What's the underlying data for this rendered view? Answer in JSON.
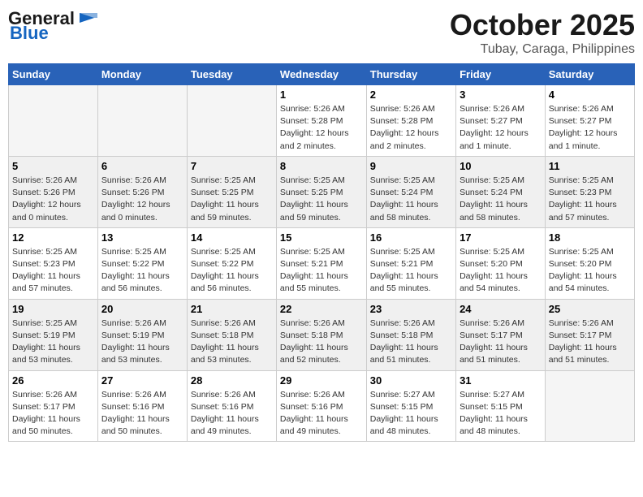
{
  "header": {
    "logo_line1": "General",
    "logo_line2": "Blue",
    "month": "October 2025",
    "location": "Tubay, Caraga, Philippines"
  },
  "weekdays": [
    "Sunday",
    "Monday",
    "Tuesday",
    "Wednesday",
    "Thursday",
    "Friday",
    "Saturday"
  ],
  "weeks": [
    [
      {
        "day": "",
        "info": ""
      },
      {
        "day": "",
        "info": ""
      },
      {
        "day": "",
        "info": ""
      },
      {
        "day": "1",
        "info": "Sunrise: 5:26 AM\nSunset: 5:28 PM\nDaylight: 12 hours\nand 2 minutes."
      },
      {
        "day": "2",
        "info": "Sunrise: 5:26 AM\nSunset: 5:28 PM\nDaylight: 12 hours\nand 2 minutes."
      },
      {
        "day": "3",
        "info": "Sunrise: 5:26 AM\nSunset: 5:27 PM\nDaylight: 12 hours\nand 1 minute."
      },
      {
        "day": "4",
        "info": "Sunrise: 5:26 AM\nSunset: 5:27 PM\nDaylight: 12 hours\nand 1 minute."
      }
    ],
    [
      {
        "day": "5",
        "info": "Sunrise: 5:26 AM\nSunset: 5:26 PM\nDaylight: 12 hours\nand 0 minutes."
      },
      {
        "day": "6",
        "info": "Sunrise: 5:26 AM\nSunset: 5:26 PM\nDaylight: 12 hours\nand 0 minutes."
      },
      {
        "day": "7",
        "info": "Sunrise: 5:25 AM\nSunset: 5:25 PM\nDaylight: 11 hours\nand 59 minutes."
      },
      {
        "day": "8",
        "info": "Sunrise: 5:25 AM\nSunset: 5:25 PM\nDaylight: 11 hours\nand 59 minutes."
      },
      {
        "day": "9",
        "info": "Sunrise: 5:25 AM\nSunset: 5:24 PM\nDaylight: 11 hours\nand 58 minutes."
      },
      {
        "day": "10",
        "info": "Sunrise: 5:25 AM\nSunset: 5:24 PM\nDaylight: 11 hours\nand 58 minutes."
      },
      {
        "day": "11",
        "info": "Sunrise: 5:25 AM\nSunset: 5:23 PM\nDaylight: 11 hours\nand 57 minutes."
      }
    ],
    [
      {
        "day": "12",
        "info": "Sunrise: 5:25 AM\nSunset: 5:23 PM\nDaylight: 11 hours\nand 57 minutes."
      },
      {
        "day": "13",
        "info": "Sunrise: 5:25 AM\nSunset: 5:22 PM\nDaylight: 11 hours\nand 56 minutes."
      },
      {
        "day": "14",
        "info": "Sunrise: 5:25 AM\nSunset: 5:22 PM\nDaylight: 11 hours\nand 56 minutes."
      },
      {
        "day": "15",
        "info": "Sunrise: 5:25 AM\nSunset: 5:21 PM\nDaylight: 11 hours\nand 55 minutes."
      },
      {
        "day": "16",
        "info": "Sunrise: 5:25 AM\nSunset: 5:21 PM\nDaylight: 11 hours\nand 55 minutes."
      },
      {
        "day": "17",
        "info": "Sunrise: 5:25 AM\nSunset: 5:20 PM\nDaylight: 11 hours\nand 54 minutes."
      },
      {
        "day": "18",
        "info": "Sunrise: 5:25 AM\nSunset: 5:20 PM\nDaylight: 11 hours\nand 54 minutes."
      }
    ],
    [
      {
        "day": "19",
        "info": "Sunrise: 5:25 AM\nSunset: 5:19 PM\nDaylight: 11 hours\nand 53 minutes."
      },
      {
        "day": "20",
        "info": "Sunrise: 5:26 AM\nSunset: 5:19 PM\nDaylight: 11 hours\nand 53 minutes."
      },
      {
        "day": "21",
        "info": "Sunrise: 5:26 AM\nSunset: 5:18 PM\nDaylight: 11 hours\nand 53 minutes."
      },
      {
        "day": "22",
        "info": "Sunrise: 5:26 AM\nSunset: 5:18 PM\nDaylight: 11 hours\nand 52 minutes."
      },
      {
        "day": "23",
        "info": "Sunrise: 5:26 AM\nSunset: 5:18 PM\nDaylight: 11 hours\nand 51 minutes."
      },
      {
        "day": "24",
        "info": "Sunrise: 5:26 AM\nSunset: 5:17 PM\nDaylight: 11 hours\nand 51 minutes."
      },
      {
        "day": "25",
        "info": "Sunrise: 5:26 AM\nSunset: 5:17 PM\nDaylight: 11 hours\nand 51 minutes."
      }
    ],
    [
      {
        "day": "26",
        "info": "Sunrise: 5:26 AM\nSunset: 5:17 PM\nDaylight: 11 hours\nand 50 minutes."
      },
      {
        "day": "27",
        "info": "Sunrise: 5:26 AM\nSunset: 5:16 PM\nDaylight: 11 hours\nand 50 minutes."
      },
      {
        "day": "28",
        "info": "Sunrise: 5:26 AM\nSunset: 5:16 PM\nDaylight: 11 hours\nand 49 minutes."
      },
      {
        "day": "29",
        "info": "Sunrise: 5:26 AM\nSunset: 5:16 PM\nDaylight: 11 hours\nand 49 minutes."
      },
      {
        "day": "30",
        "info": "Sunrise: 5:27 AM\nSunset: 5:15 PM\nDaylight: 11 hours\nand 48 minutes."
      },
      {
        "day": "31",
        "info": "Sunrise: 5:27 AM\nSunset: 5:15 PM\nDaylight: 11 hours\nand 48 minutes."
      },
      {
        "day": "",
        "info": ""
      }
    ]
  ]
}
